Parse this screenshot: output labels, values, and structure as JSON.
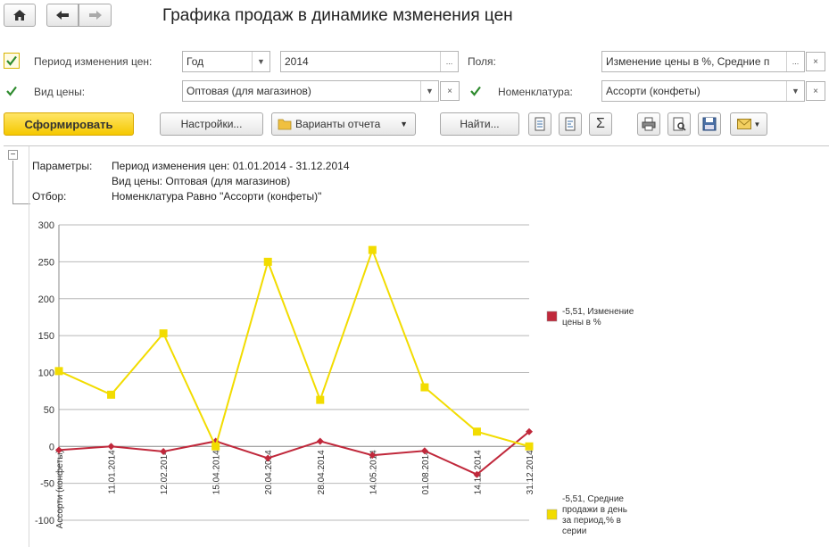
{
  "header": {
    "title": "Графика продаж в динамике мзменения цен"
  },
  "filters": {
    "period_label": "Период изменения цен:",
    "period_type": "Год",
    "period_value": "2014",
    "fields_label": "Поля:",
    "fields_value": "Изменение цены в %, Средние п",
    "price_type_label": "Вид цены:",
    "price_type_value": "Оптовая (для магазинов)",
    "nomenclature_label": "Номенклатура:",
    "nomenclature_value": "Ассорти (конфеты)",
    "ellipsis": "...",
    "clear": "×"
  },
  "toolbar": {
    "generate_label": "Сформировать",
    "settings_label": "Настройки...",
    "variants_label": "Варианты отчета",
    "find_label": "Найти...",
    "sum_glyph": "Σ"
  },
  "report": {
    "collapse_glyph": "−",
    "params_label": "Параметры:",
    "params_line1": "Период изменения цен: 01.01.2014 - 31.12.2014",
    "params_line2": "Вид цены: Оптовая (для магазинов)",
    "filter_label": "Отбор:",
    "filter_line": "Номенклатура Равно \"Ассорти (конфеты)\""
  },
  "chart_data": {
    "type": "line",
    "ylim": [
      -100,
      300
    ],
    "yticks": [
      300,
      250,
      200,
      150,
      100,
      50,
      0,
      -50,
      -100
    ],
    "categories": [
      "Ассорти (конфеты)",
      "11.01.2014",
      "12.02.2014",
      "15.04.2014",
      "20.04.2014",
      "28.04.2014",
      "14.05.2014",
      "01.08.2014",
      "14.12.2014",
      "31.12.2014"
    ],
    "series": [
      {
        "name": "-5,51, Изменение цены в %",
        "color": "#c0283b",
        "marker": "diamond",
        "values": [
          -5,
          0,
          -7,
          7,
          -16,
          7,
          -12,
          -6,
          -38,
          20
        ]
      },
      {
        "name": "-5,51, Средние продажи в день за период,% в серии",
        "color": "#f2dc00",
        "marker": "square",
        "values": [
          102,
          70,
          153,
          0,
          250,
          63,
          266,
          80,
          20,
          0
        ]
      }
    ],
    "legend": [
      {
        "line1": "-5,51, Изменение",
        "line2": "цены в %",
        "line3": "",
        "line4": ""
      },
      {
        "line1": "-5,51, Средние",
        "line2": "продажи в день",
        "line3": "за период,% в",
        "line4": "серии"
      }
    ],
    "grid": true,
    "legend_position": "right"
  },
  "icons": {
    "home": "home-icon",
    "back": "arrow-left-icon",
    "forward": "arrow-right-icon"
  }
}
